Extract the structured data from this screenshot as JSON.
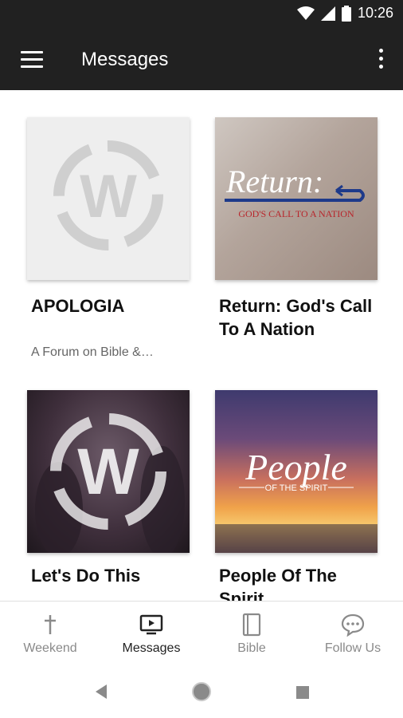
{
  "status": {
    "time": "10:26"
  },
  "appbar": {
    "title": "Messages"
  },
  "cards": [
    {
      "title": "APOLOGIA",
      "subtitle": "A Forum on Bible &…",
      "image": "w-logo-gray"
    },
    {
      "title": "Return: God's Call To A Nation",
      "subtitle": "",
      "image": "return-artwork",
      "art_title": "Return:",
      "art_subtitle": "GOD'S CALL TO A NATION"
    },
    {
      "title": "Let's Do This",
      "subtitle": "",
      "image": "worship-crowd-w-logo"
    },
    {
      "title": "People Of The Spirit",
      "subtitle": "",
      "image": "sunset-artwork",
      "art_title": "People",
      "art_subtitle": "OF THE SPIRIT"
    }
  ],
  "bottom_nav": [
    {
      "label": "Weekend",
      "icon": "cross-icon",
      "active": false
    },
    {
      "label": "Messages",
      "icon": "tv-play-icon",
      "active": true
    },
    {
      "label": "Bible",
      "icon": "book-icon",
      "active": false
    },
    {
      "label": "Follow Us",
      "icon": "chat-bubble-icon",
      "active": false
    }
  ],
  "colors": {
    "appbar": "#212121",
    "active_nav": "#222222",
    "inactive_nav": "#8a8a8a",
    "return_blue": "#1e3a8a",
    "return_red": "#b8252b"
  }
}
